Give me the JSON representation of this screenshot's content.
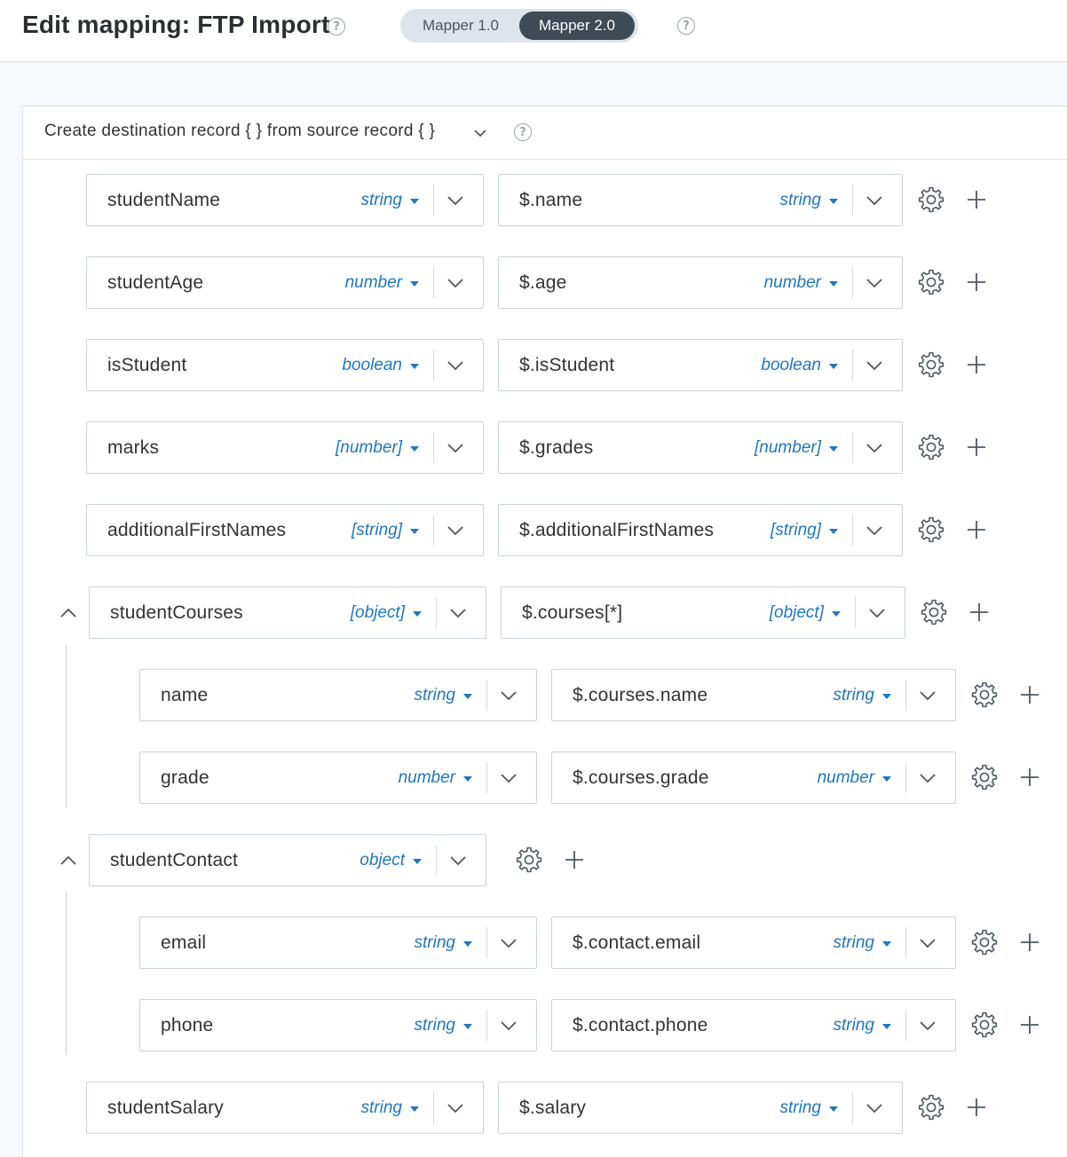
{
  "header": {
    "title": "Edit mapping: FTP Import",
    "help_icon": "question-circle-icon",
    "mapper_toggle": {
      "options": [
        "Mapper 1.0",
        "Mapper 2.0"
      ],
      "selected": "Mapper 2.0"
    }
  },
  "panel": {
    "description": "Create destination record { } from source record { }",
    "rows": [
      {
        "dest": "studentName",
        "dest_type": "string",
        "source": "$.name",
        "source_type": "string"
      },
      {
        "dest": "studentAge",
        "dest_type": "number",
        "source": "$.age",
        "source_type": "number"
      },
      {
        "dest": "isStudent",
        "dest_type": "boolean",
        "source": "$.isStudent",
        "source_type": "boolean"
      },
      {
        "dest": "marks",
        "dest_type": "[number]",
        "source": "$.grades",
        "source_type": "[number]"
      },
      {
        "dest": "additionalFirstNames",
        "dest_type": "[string]",
        "source": "$.additionalFirstNames",
        "source_type": "[string]"
      },
      {
        "dest": "studentCourses",
        "dest_type": "[object]",
        "source": "$.courses[*]",
        "source_type": "[object]",
        "expanded": true
      },
      {
        "dest": "name",
        "dest_type": "string",
        "source": "$.courses.name",
        "source_type": "string",
        "parent": "studentCourses"
      },
      {
        "dest": "grade",
        "dest_type": "number",
        "source": "$.courses.grade",
        "source_type": "number",
        "parent": "studentCourses"
      },
      {
        "dest": "studentContact",
        "dest_type": "object",
        "expanded": true
      },
      {
        "dest": "email",
        "dest_type": "string",
        "source": "$.contact.email",
        "source_type": "string",
        "parent": "studentContact"
      },
      {
        "dest": "phone",
        "dest_type": "string",
        "source": "$.contact.phone",
        "source_type": "string",
        "parent": "studentContact"
      },
      {
        "dest": "studentSalary",
        "dest_type": "string",
        "source": "$.salary",
        "source_type": "string"
      }
    ]
  },
  "colors": {
    "type_accent": "#1f76c2",
    "toggle_active": "#3f4a55",
    "toggle_track": "#dde4ec"
  }
}
